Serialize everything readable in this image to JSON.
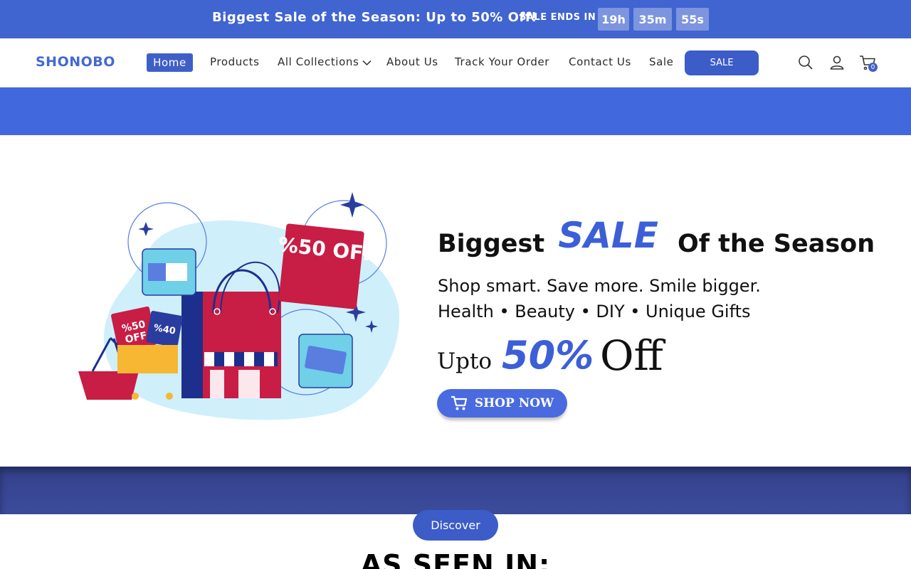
{
  "announcement": {
    "text": "Biggest Sale of the Season: Up to 50% Off!",
    "ends_label": "SALE ENDS IN",
    "hours": "19h",
    "minutes": "35m",
    "seconds": "55s"
  },
  "header": {
    "logo": "SHONOBO",
    "nav": {
      "home": "Home",
      "products": "Products",
      "collections": "All Collections",
      "about": "About Us",
      "track": "Track Your Order",
      "contact": "Contact Us",
      "sale": "Sale"
    },
    "sale_button": "SALE",
    "cart_count": "0",
    "icons": [
      "search-icon",
      "account-icon",
      "cart-icon",
      "chevron-down-icon"
    ]
  },
  "hero": {
    "title_a": "Biggest",
    "title_b": "SALE",
    "title_c": "Of the Season",
    "line1": "Shop smart. Save more. Smile bigger.",
    "line2": "Health • Beauty • DIY • Unique Gifts",
    "upto": "Upto",
    "percent": "50%",
    "off": "Off",
    "cta": "SHOP NOW",
    "tag1": "%50 OFF",
    "tag_small1": "%50",
    "tag_small1b": "OFF",
    "tag_small2": "%40"
  },
  "discover_button": "Discover",
  "as_seen_in": "AS SEEN IN:",
  "colors": {
    "brand": "#4064d0",
    "button": "#3c5cc8",
    "band_top": "#4169dd",
    "band_bottom": "#3c4c9c",
    "tag_red": "#c81d45"
  }
}
